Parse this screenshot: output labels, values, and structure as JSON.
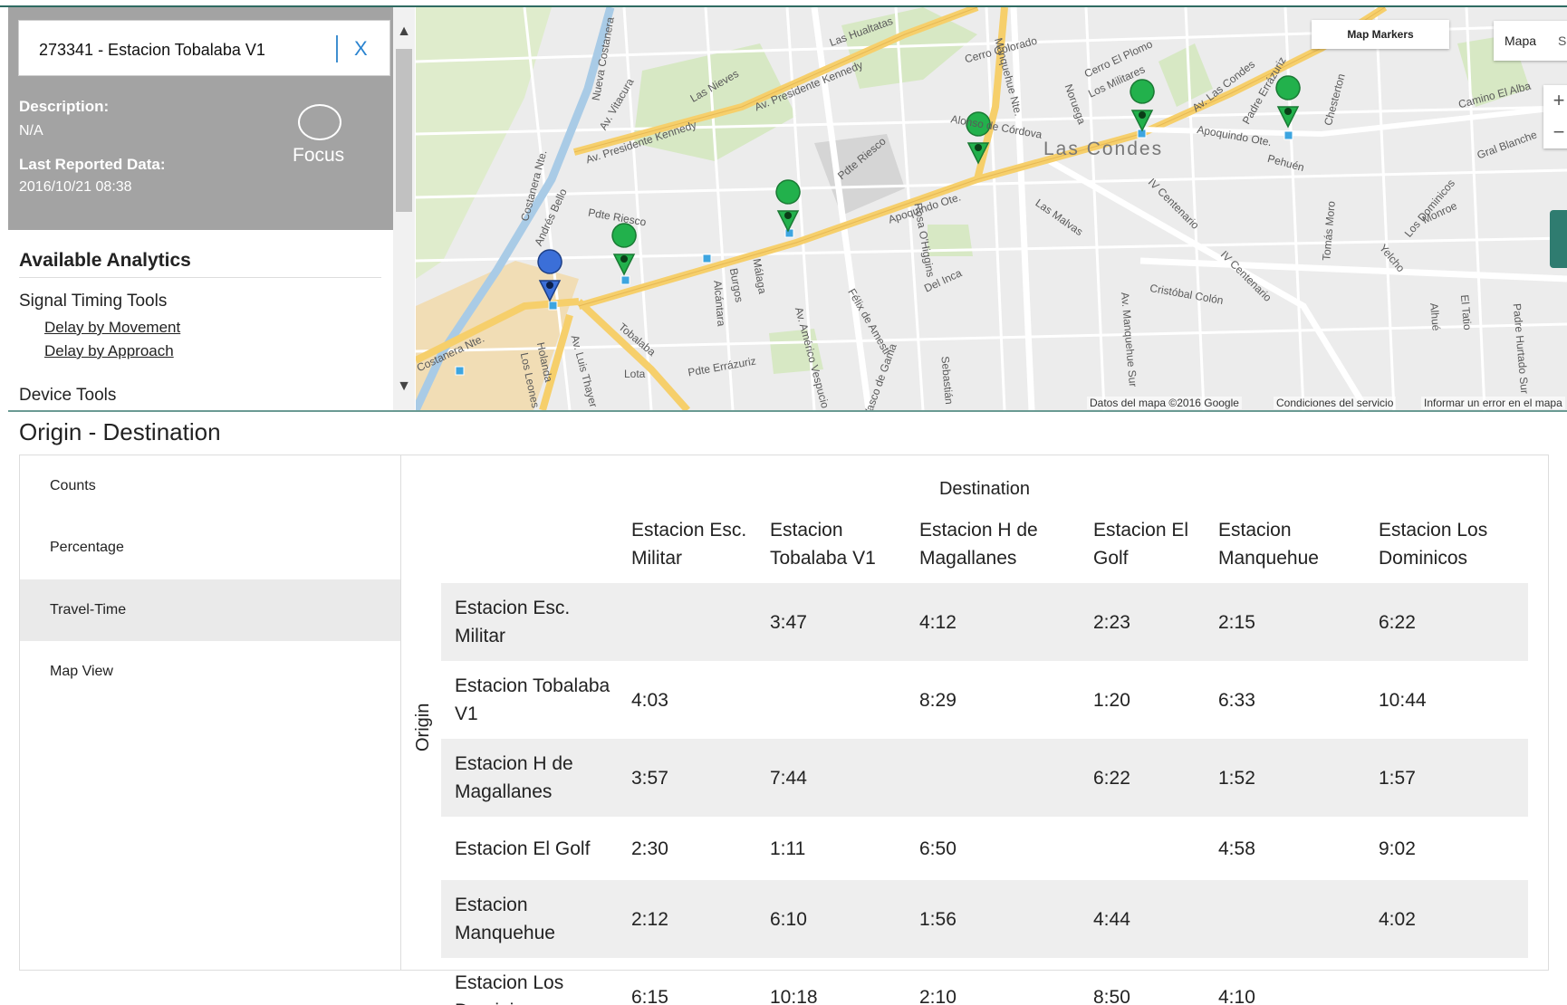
{
  "info_panel": {
    "search_value": "273341 - Estacion Tobalaba V1",
    "clear_label": "X",
    "description_label": "Description:",
    "description_value": "N/A",
    "last_reported_label": "Last Reported Data:",
    "last_reported_value": "2016/10/21 08:38",
    "focus_label": "Focus"
  },
  "analytics": {
    "title": "Available Analytics",
    "group_1": "Signal Timing Tools",
    "link_1": "Delay by Movement",
    "link_2": "Delay by Approach",
    "group_2": "Device Tools"
  },
  "scrollbar": {
    "up": "▲",
    "down": "▼"
  },
  "map": {
    "map_markers_label": "Map Markers",
    "type_map": "Mapa",
    "type_satellite": "Satélite",
    "zoom_in": "+",
    "zoom_out": "−",
    "footer_data": "Datos del mapa ©2016 Google",
    "footer_terms": "Condiciones del servicio",
    "footer_report": "Informar un error en el mapa",
    "district": "Las Condes",
    "street_labels": [
      "Av. Presidente Kennedy",
      "Av. Presidente Kennedy",
      "Apoquindo Ote.",
      "Av. Las Condes",
      "Tobalaba",
      "Costanera Nte.",
      "Costanera Nte.",
      "Pdte Riesco",
      "Pdte Riesco",
      "Alonso de Córdova",
      "Cerro Colorado",
      "Cerro El Plomo",
      "Los Militares",
      "Av. Vitacura",
      "Nueva Costanera",
      "Las Nieves",
      "Las Hualtatas",
      "Andrés Bello",
      "Pdte Errázuriz",
      "Lota",
      "Av. Luis Thayer",
      "Los Leones",
      "Holanda",
      "Málaga",
      "Alcántara",
      "Rosa O'Higgins",
      "Del Inca",
      "Félix de Amesti",
      "Av. Américo Vespucio",
      "Las Malvas",
      "Cristóbal Colón",
      "IV Centenario",
      "IV Centenario",
      "Av. Manquehue Sur",
      "Manquehue Nte.",
      "Noruega",
      "Padre Errázuriz",
      "Chesterton",
      "Camino El Alba",
      "Gral Blanche",
      "Los Dominicos",
      "Monroe",
      "Tomás Moro",
      "Pehuén",
      "Yelcho",
      "El Tatio",
      "Alhué",
      "Padre Hurtado Sur",
      "Sebastián",
      "Burgos",
      "Vasco de Gama",
      "Apoquindo Ote."
    ],
    "markers": [
      {
        "name": "Estacion Esc. Militar",
        "color": "#22b14c"
      },
      {
        "name": "Estacion Tobalaba V1",
        "color": "#3b6fd8"
      },
      {
        "name": "Estacion H de Magallanes",
        "color": "#22b14c"
      },
      {
        "name": "Estacion El Golf",
        "color": "#22b14c"
      },
      {
        "name": "Estacion Manquehue",
        "color": "#22b14c"
      },
      {
        "name": "Estacion Los Dominicos",
        "color": "#22b14c"
      }
    ]
  },
  "od": {
    "title": "Origin - Destination",
    "tabs": [
      "Counts",
      "Percentage",
      "Travel-Time",
      "Map View"
    ],
    "active_tab": "Travel-Time",
    "destination_label": "Destination",
    "origin_label": "Origin",
    "columns": [
      "Estacion Esc. Militar",
      "Estacion Tobalaba V1",
      "Estacion H de Magallanes",
      "Estacion El Golf",
      "Estacion Manquehue",
      "Estacion Los Dominicos"
    ],
    "rows": [
      {
        "origin": "Estacion Esc. Militar",
        "values": [
          "",
          "3:47",
          "4:12",
          "2:23",
          "2:15",
          "6:22"
        ]
      },
      {
        "origin": "Estacion Tobalaba V1",
        "values": [
          "4:03",
          "",
          "8:29",
          "1:20",
          "6:33",
          "10:44"
        ]
      },
      {
        "origin": "Estacion H de Magallanes",
        "values": [
          "3:57",
          "7:44",
          "",
          "6:22",
          "1:52",
          "1:57"
        ]
      },
      {
        "origin": "Estacion El Golf",
        "values": [
          "2:30",
          "1:11",
          "6:50",
          "",
          "4:58",
          "9:02"
        ]
      },
      {
        "origin": "Estacion Manquehue",
        "values": [
          "2:12",
          "6:10",
          "1:56",
          "4:44",
          "",
          "4:02"
        ]
      },
      {
        "origin": "Estacion Los Dominicos",
        "values": [
          "6:15",
          "10:18",
          "2:10",
          "8:50",
          "4:10",
          ""
        ]
      }
    ]
  },
  "colors": {
    "panel_gray": "#a3a3a3",
    "accent_teal": "#2f6b62",
    "marker_green": "#22b14c",
    "marker_blue": "#3b6fd8",
    "road_yellow": "#f6cf6b"
  }
}
